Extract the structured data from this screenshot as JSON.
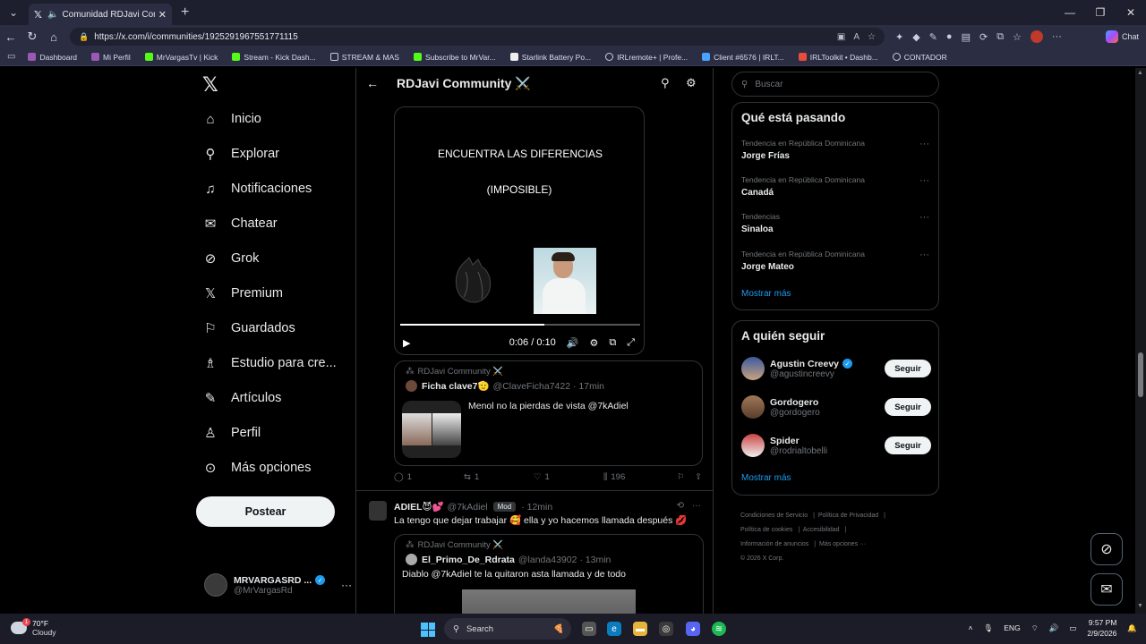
{
  "browser": {
    "tab_title": "Comunidad RDJavi Communi",
    "url": "https://x.com/i/communities/1925291967551771115",
    "chat_label": "Chat",
    "bookmarks": [
      "Dashboard",
      "Mi Perfil",
      "MrVargasTv | Kick",
      "Stream - Kick Dash...",
      "STREAM & MAS",
      "Subscribe to MrVar...",
      "Starlink Battery Po...",
      "IRLremote+ | Profe...",
      "Client #6576 | IRLT...",
      "IRLToolkit • Dashb...",
      "CONTADOR"
    ]
  },
  "nav": {
    "items": [
      "Inicio",
      "Explorar",
      "Notificaciones",
      "Chatear",
      "Grok",
      "Premium",
      "Guardados",
      "Estudio para cre...",
      "Artículos",
      "Perfil",
      "Más opciones"
    ],
    "post_button": "Postear",
    "account_name": "MRVARGASRD ...",
    "account_handle": "@MrVargasRd"
  },
  "main": {
    "header_title": "RDJavi Community ⚔️",
    "video": {
      "line1": "ENCUENTRA LAS DIFERENCIAS",
      "line2": "(IMPOSIBLE)",
      "time": "0:06 / 0:10",
      "progress": 0.6
    },
    "quote1": {
      "community": "RDJavi Community ⚔️",
      "name": "Ficha clave7🫡",
      "handle": "@ClaveFicha7422 · 17min",
      "text": "Menol no la pierdas de vista @7kAdiel"
    },
    "actions": {
      "replies": "1",
      "reposts": "1",
      "likes": "1",
      "views": "196"
    },
    "post2": {
      "name": "ADIEL😈💕",
      "handle": "@7kAdiel",
      "badge": "Mod",
      "time": "· 12min",
      "text": "La tengo que dejar trabajar 🥰 ella y yo hacemos llamada después 💋"
    },
    "quote2": {
      "community": "RDJavi Community ⚔️",
      "name": "El_Primo_De_Rdrata",
      "handle": "@landa43902 · 13min",
      "text": "Diablo @7kAdiel te la quitaron asta llamada y de todo"
    }
  },
  "right": {
    "search_placeholder": "Buscar",
    "trends_title": "Qué está pasando",
    "trends": [
      {
        "context": "Tendencia en República Dominicana",
        "name": "Jorge Frías"
      },
      {
        "context": "Tendencia en República Dominicana",
        "name": "Canadá"
      },
      {
        "context": "Tendencias",
        "name": "Sinaloa"
      },
      {
        "context": "Tendencia en República Dominicana",
        "name": "Jorge Mateo"
      }
    ],
    "show_more": "Mostrar más",
    "follow_title": "A quién seguir",
    "follow": [
      {
        "name": "Agustin Creevy",
        "handle": "@agustincreevy",
        "verified": true
      },
      {
        "name": "Gordogero",
        "handle": "@gordogero",
        "verified": false
      },
      {
        "name": "Spider",
        "handle": "@rodrialtobelli",
        "verified": false
      }
    ],
    "follow_button": "Seguir",
    "footer": [
      "Condiciones de Servicio",
      "Política de Privacidad",
      "Política de cookies",
      "Accesibilidad",
      "Información de anuncios",
      "Más opciones ···",
      "© 2026 X Corp."
    ]
  },
  "taskbar": {
    "temp": "70°F",
    "weather": "Cloudy",
    "search": "Search",
    "lang": "ENG",
    "time": "9:57 PM",
    "date": "2/9/2026"
  }
}
